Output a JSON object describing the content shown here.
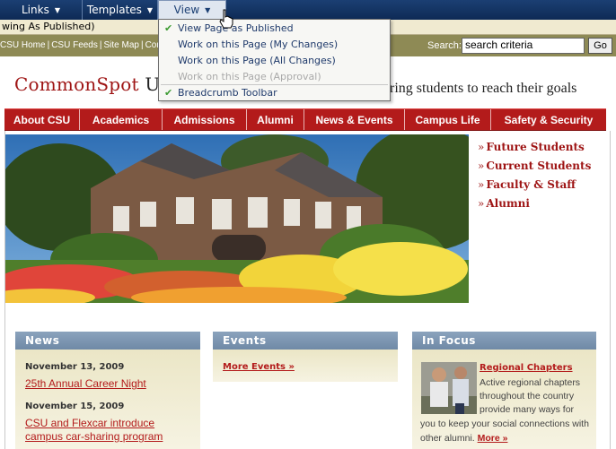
{
  "toolbar": {
    "links_label": "Links",
    "templates_label": "Templates",
    "view_label": "View",
    "status_text": "wing As Published)"
  },
  "view_menu": {
    "items": [
      {
        "label": "View Page as Published",
        "checked": true,
        "enabled": true
      },
      {
        "label": "Work on this Page (My Changes)",
        "checked": false,
        "enabled": true
      },
      {
        "label": "Work on this Page (All Changes)",
        "checked": false,
        "enabled": true
      },
      {
        "label": "Work on this Page (Approval)",
        "checked": false,
        "enabled": false
      },
      {
        "label": "Breadcrumb Toolbar",
        "checked": true,
        "enabled": true
      }
    ]
  },
  "utility": {
    "links": [
      "CSU Home",
      "CSU Feeds",
      "Site Map",
      "Con"
    ],
    "search_label": "Search:",
    "search_value": "search criteria",
    "go_label": "Go"
  },
  "brand": {
    "logo_main": "CommonSpot",
    "logo_u": "U",
    "tagline": "ring students to reach their goals"
  },
  "nav": {
    "items": [
      "About CSU",
      "Academics",
      "Admissions",
      "Alumni",
      "News & Events",
      "Campus Life",
      "Safety & Security"
    ]
  },
  "quick_links": {
    "items": [
      "Future Students",
      "Current Students",
      "Faculty & Staff",
      "Alumni"
    ]
  },
  "news": {
    "heading": "News",
    "items": [
      {
        "date": "November 13, 2009",
        "title_lines": [
          "25th Annual Career Night"
        ]
      },
      {
        "date": "November 15, 2009",
        "title_lines": [
          "CSU and Flexcar introduce",
          "campus car-sharing program"
        ]
      }
    ]
  },
  "events": {
    "heading": "Events",
    "more_label": "More Events »"
  },
  "focus": {
    "heading": "In Focus",
    "title": "Regional Chapters",
    "text_lines": [
      "Active regional chapters",
      "throughout the country",
      "provide many ways for",
      "you to keep your social connections with",
      "other alumni."
    ],
    "more_label": "More »"
  },
  "colors": {
    "toolbar": "#12315e",
    "nav_red": "#b31b1b",
    "util_olive": "#8e8a55",
    "link_red": "#b31b1b",
    "column_head": "#7f97b2",
    "column_body": "#efeacf"
  }
}
